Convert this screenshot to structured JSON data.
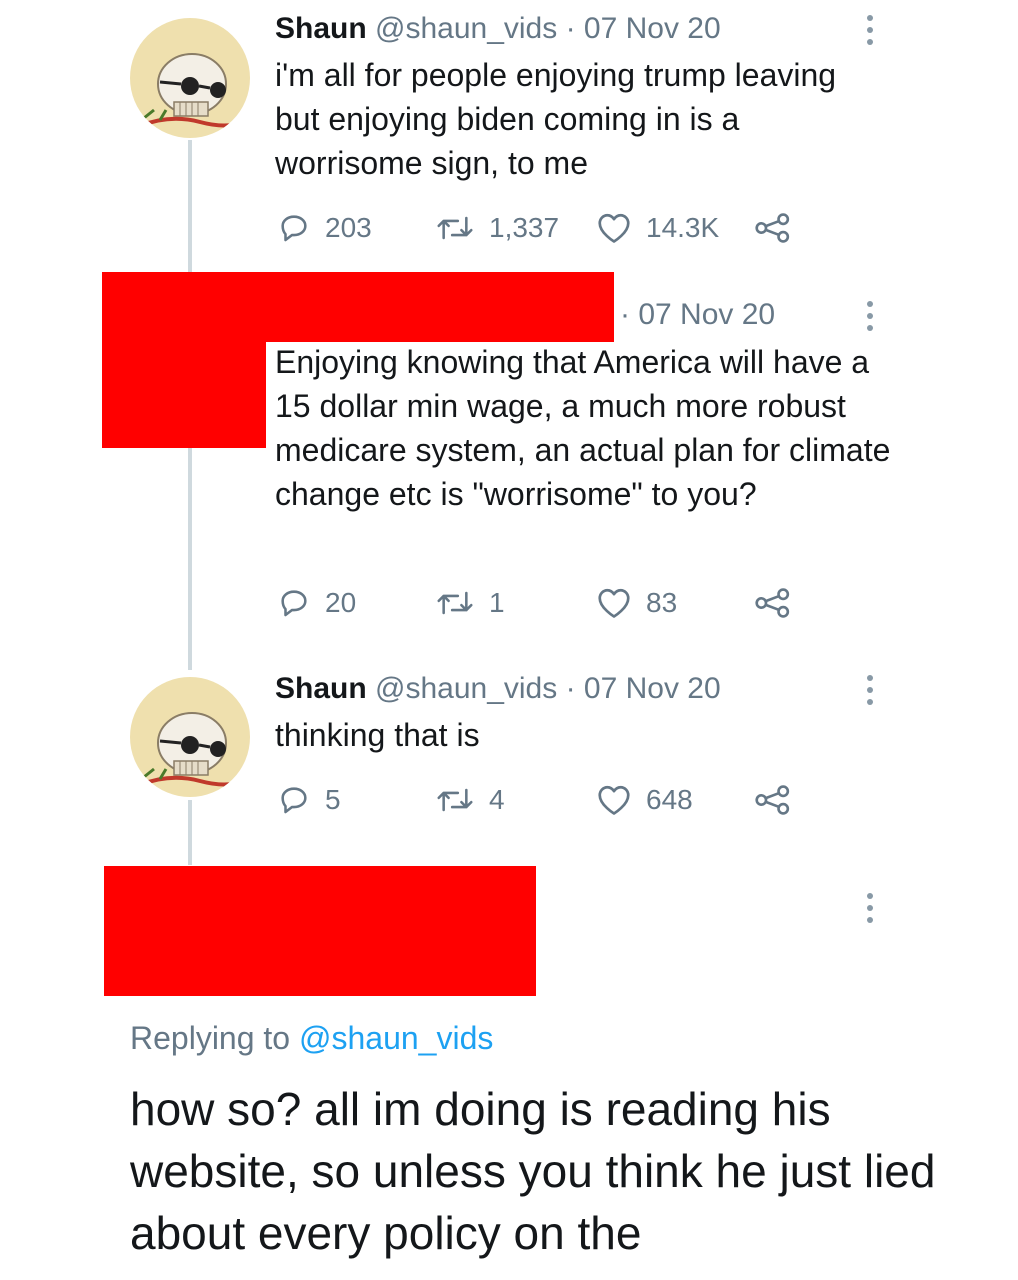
{
  "tweets": [
    {
      "name": "Shaun",
      "handle": "@shaun_vids",
      "sep": " · ",
      "date": "07 Nov 20",
      "text": "i'm all for people enjoying trump leaving but enjoying biden coming in is a worrisome sign, to me",
      "replies": "203",
      "retweets": "1,337",
      "likes": "14.3K"
    },
    {
      "name": "",
      "handle": "",
      "sep": "· ",
      "date": "07 Nov 20",
      "text": "Enjoying knowing that America will have a 15 dollar min wage, a much more robust medicare system, an actual plan for climate change etc is \"worrisome\" to you?",
      "replies": "20",
      "retweets": "1",
      "likes": "83"
    },
    {
      "name": "Shaun",
      "handle": "@shaun_vids",
      "sep": " · ",
      "date": "07 Nov 20",
      "text": "thinking that is",
      "replies": "5",
      "retweets": "4",
      "likes": "648"
    }
  ],
  "reply": {
    "prefix": "Replying to ",
    "handle": "@shaun_vids",
    "text": "how so?  all im doing is reading his website, so unless you think he just lied about every policy on the"
  },
  "colors": {
    "redaction": "#ff0000",
    "muted": "#657786",
    "link": "#1da1f2",
    "thread_line": "#cfd9de"
  },
  "icons": [
    "reply-icon",
    "retweet-icon",
    "like-icon",
    "share-icon",
    "more-options-icon"
  ]
}
